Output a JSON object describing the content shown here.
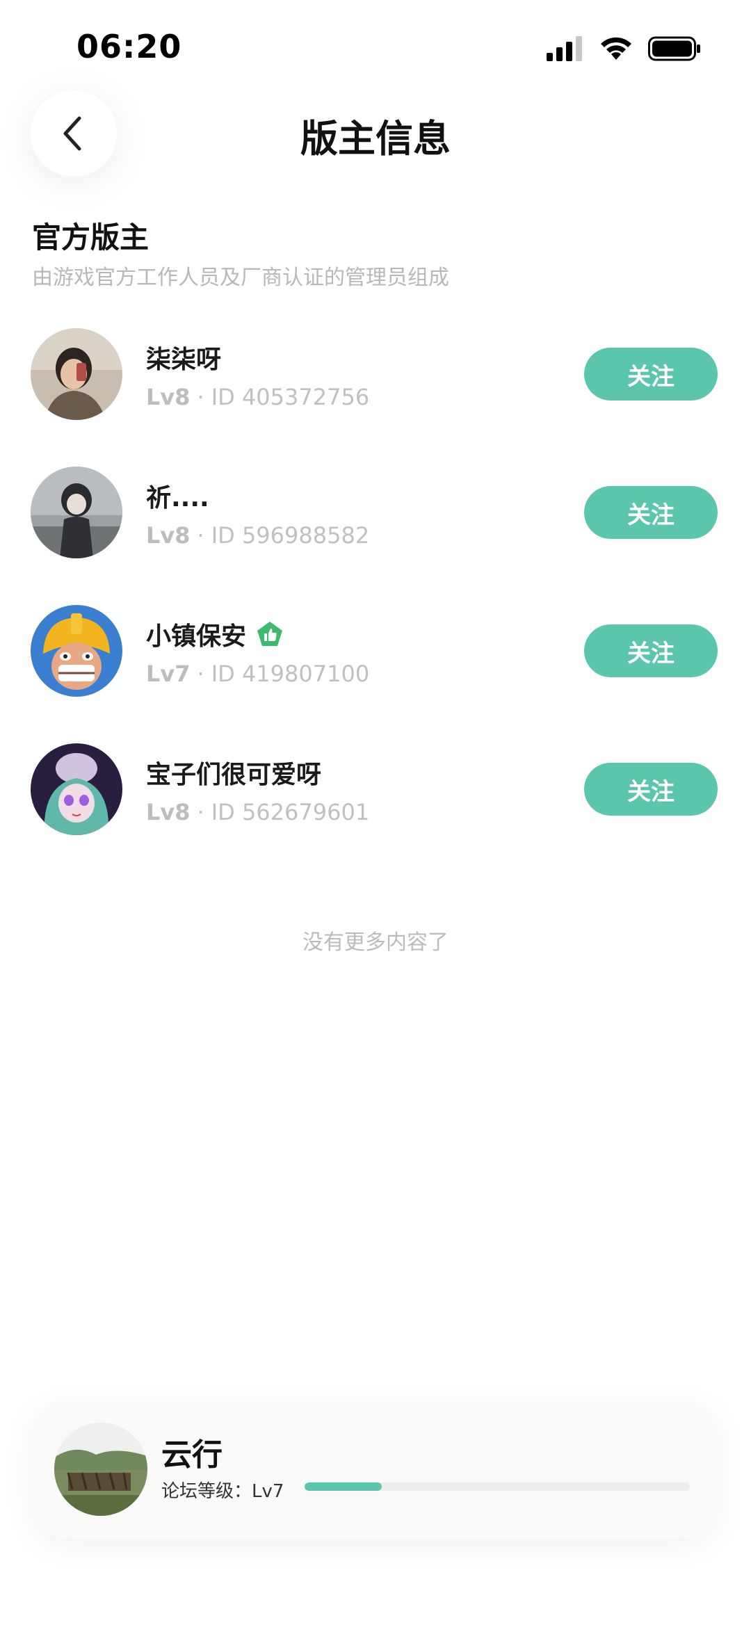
{
  "status_bar": {
    "time": "06:20"
  },
  "header": {
    "title": "版主信息"
  },
  "section": {
    "title": "官方版主",
    "description": "由游戏官方工作人员及厂商认证的管理员组成"
  },
  "moderators": [
    {
      "name": "柒柒呀",
      "level": "Lv8",
      "id_text": "ID 405372756",
      "follow_label": "关注",
      "verified": false
    },
    {
      "name": "祈....",
      "level": "Lv8",
      "id_text": "ID 596988582",
      "follow_label": "关注",
      "verified": false
    },
    {
      "name": "小镇保安",
      "level": "Lv7",
      "id_text": "ID 419807100",
      "follow_label": "关注",
      "verified": true
    },
    {
      "name": "宝子们很可爱呀",
      "level": "Lv8",
      "id_text": "ID 562679601",
      "follow_label": "关注",
      "verified": false
    }
  ],
  "separator": "·",
  "footer_text": "没有更多内容了",
  "user_card": {
    "name": "云行",
    "level_label": "论坛等级：Lv7",
    "progress": 0.2
  },
  "colors": {
    "accent": "#5cc6ad",
    "verified": "#3dbb6c"
  },
  "icons": {
    "back": "chevron-left-icon",
    "verified": "thumbs-up-badge-icon"
  }
}
